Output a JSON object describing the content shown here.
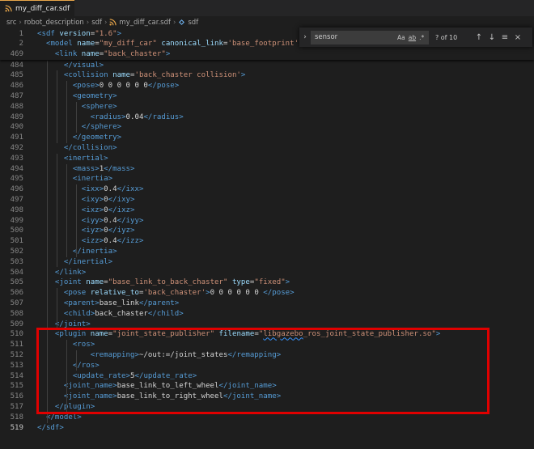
{
  "tab": {
    "label": "my_diff_car.sdf"
  },
  "breadcrumb": {
    "items": [
      "src",
      "robot_description",
      "sdf",
      "my_diff_car.sdf",
      "sdf"
    ]
  },
  "find": {
    "value": "sensor",
    "placeholder": "Find",
    "match_case": "Aa",
    "whole_word": "ab",
    "regex": ".*",
    "count": "? of 10"
  },
  "sticky_lines": [
    {
      "num": "1",
      "code": [
        [
          "t",
          "<"
        ],
        [
          "t",
          "sdf"
        ],
        [
          "x",
          " "
        ],
        [
          "a",
          "version"
        ],
        [
          "x",
          "="
        ],
        [
          "s",
          "\"1.6\""
        ],
        [
          "t",
          ">"
        ]
      ]
    },
    {
      "num": "2",
      "code": [
        [
          "x",
          "  "
        ],
        [
          "t",
          "<"
        ],
        [
          "t",
          "model"
        ],
        [
          "x",
          " "
        ],
        [
          "a",
          "name"
        ],
        [
          "x",
          "="
        ],
        [
          "s",
          "\"my_diff_car\""
        ],
        [
          "x",
          " "
        ],
        [
          "a",
          "canonical_link"
        ],
        [
          "x",
          "="
        ],
        [
          "s",
          "'base_footprint'"
        ]
      ]
    },
    {
      "num": "469",
      "code": [
        [
          "x",
          "    "
        ],
        [
          "t",
          "<"
        ],
        [
          "t",
          "link"
        ],
        [
          "x",
          " "
        ],
        [
          "a",
          "name"
        ],
        [
          "x",
          "="
        ],
        [
          "s",
          "\"back_chaster\""
        ],
        [
          "t",
          ">"
        ]
      ]
    }
  ],
  "lines": [
    {
      "num": "484",
      "code": [
        [
          "x",
          "      "
        ],
        [
          "t",
          "</"
        ],
        [
          "t",
          "visual"
        ],
        [
          "t",
          ">"
        ]
      ]
    },
    {
      "num": "485",
      "code": [
        [
          "x",
          "      "
        ],
        [
          "t",
          "<"
        ],
        [
          "t",
          "collision"
        ],
        [
          "x",
          " "
        ],
        [
          "a",
          "name"
        ],
        [
          "x",
          "="
        ],
        [
          "s",
          "'back_chaster collision'"
        ],
        [
          "t",
          ">"
        ]
      ]
    },
    {
      "num": "486",
      "code": [
        [
          "x",
          "        "
        ],
        [
          "t",
          "<"
        ],
        [
          "t",
          "pose"
        ],
        [
          "t",
          ">"
        ],
        [
          "x",
          "0 0 0 0 0 0"
        ],
        [
          "t",
          "</"
        ],
        [
          "t",
          "pose"
        ],
        [
          "t",
          ">"
        ]
      ]
    },
    {
      "num": "487",
      "code": [
        [
          "x",
          "        "
        ],
        [
          "t",
          "<"
        ],
        [
          "t",
          "geometry"
        ],
        [
          "t",
          ">"
        ]
      ]
    },
    {
      "num": "488",
      "code": [
        [
          "x",
          "          "
        ],
        [
          "t",
          "<"
        ],
        [
          "t",
          "sphere"
        ],
        [
          "t",
          ">"
        ]
      ]
    },
    {
      "num": "489",
      "code": [
        [
          "x",
          "            "
        ],
        [
          "t",
          "<"
        ],
        [
          "t",
          "radius"
        ],
        [
          "t",
          ">"
        ],
        [
          "x",
          "0.04"
        ],
        [
          "t",
          "</"
        ],
        [
          "t",
          "radius"
        ],
        [
          "t",
          ">"
        ]
      ]
    },
    {
      "num": "490",
      "code": [
        [
          "x",
          "          "
        ],
        [
          "t",
          "</"
        ],
        [
          "t",
          "sphere"
        ],
        [
          "t",
          ">"
        ]
      ]
    },
    {
      "num": "491",
      "code": [
        [
          "x",
          "        "
        ],
        [
          "t",
          "</"
        ],
        [
          "t",
          "geometry"
        ],
        [
          "t",
          ">"
        ]
      ]
    },
    {
      "num": "492",
      "code": [
        [
          "x",
          "      "
        ],
        [
          "t",
          "</"
        ],
        [
          "t",
          "collision"
        ],
        [
          "t",
          ">"
        ]
      ]
    },
    {
      "num": "493",
      "code": [
        [
          "x",
          "      "
        ],
        [
          "t",
          "<"
        ],
        [
          "t",
          "inertial"
        ],
        [
          "t",
          ">"
        ]
      ]
    },
    {
      "num": "494",
      "code": [
        [
          "x",
          "        "
        ],
        [
          "t",
          "<"
        ],
        [
          "t",
          "mass"
        ],
        [
          "t",
          ">"
        ],
        [
          "x",
          "1"
        ],
        [
          "t",
          "</"
        ],
        [
          "t",
          "mass"
        ],
        [
          "t",
          ">"
        ]
      ]
    },
    {
      "num": "495",
      "code": [
        [
          "x",
          "        "
        ],
        [
          "t",
          "<"
        ],
        [
          "t",
          "inertia"
        ],
        [
          "t",
          ">"
        ]
      ]
    },
    {
      "num": "496",
      "code": [
        [
          "x",
          "          "
        ],
        [
          "t",
          "<"
        ],
        [
          "t",
          "ixx"
        ],
        [
          "t",
          ">"
        ],
        [
          "x",
          "0.4"
        ],
        [
          "t",
          "</"
        ],
        [
          "t",
          "ixx"
        ],
        [
          "t",
          ">"
        ]
      ]
    },
    {
      "num": "497",
      "code": [
        [
          "x",
          "          "
        ],
        [
          "t",
          "<"
        ],
        [
          "t",
          "ixy"
        ],
        [
          "t",
          ">"
        ],
        [
          "x",
          "0"
        ],
        [
          "t",
          "</"
        ],
        [
          "t",
          "ixy"
        ],
        [
          "t",
          ">"
        ]
      ]
    },
    {
      "num": "498",
      "code": [
        [
          "x",
          "          "
        ],
        [
          "t",
          "<"
        ],
        [
          "t",
          "ixz"
        ],
        [
          "t",
          ">"
        ],
        [
          "x",
          "0"
        ],
        [
          "t",
          "</"
        ],
        [
          "t",
          "ixz"
        ],
        [
          "t",
          ">"
        ]
      ]
    },
    {
      "num": "499",
      "code": [
        [
          "x",
          "          "
        ],
        [
          "t",
          "<"
        ],
        [
          "t",
          "iyy"
        ],
        [
          "t",
          ">"
        ],
        [
          "x",
          "0.4"
        ],
        [
          "t",
          "</"
        ],
        [
          "t",
          "iyy"
        ],
        [
          "t",
          ">"
        ]
      ]
    },
    {
      "num": "500",
      "code": [
        [
          "x",
          "          "
        ],
        [
          "t",
          "<"
        ],
        [
          "t",
          "iyz"
        ],
        [
          "t",
          ">"
        ],
        [
          "x",
          "0"
        ],
        [
          "t",
          "</"
        ],
        [
          "t",
          "iyz"
        ],
        [
          "t",
          ">"
        ]
      ]
    },
    {
      "num": "501",
      "code": [
        [
          "x",
          "          "
        ],
        [
          "t",
          "<"
        ],
        [
          "t",
          "izz"
        ],
        [
          "t",
          ">"
        ],
        [
          "x",
          "0.4"
        ],
        [
          "t",
          "</"
        ],
        [
          "t",
          "izz"
        ],
        [
          "t",
          ">"
        ]
      ]
    },
    {
      "num": "502",
      "code": [
        [
          "x",
          "        "
        ],
        [
          "t",
          "</"
        ],
        [
          "t",
          "inertia"
        ],
        [
          "t",
          ">"
        ]
      ]
    },
    {
      "num": "503",
      "code": [
        [
          "x",
          "      "
        ],
        [
          "t",
          "</"
        ],
        [
          "t",
          "inertial"
        ],
        [
          "t",
          ">"
        ]
      ]
    },
    {
      "num": "504",
      "code": [
        [
          "x",
          "    "
        ],
        [
          "t",
          "</"
        ],
        [
          "t",
          "link"
        ],
        [
          "t",
          ">"
        ]
      ]
    },
    {
      "num": "505",
      "code": [
        [
          "x",
          "    "
        ],
        [
          "t",
          "<"
        ],
        [
          "t",
          "joint"
        ],
        [
          "x",
          " "
        ],
        [
          "a",
          "name"
        ],
        [
          "x",
          "="
        ],
        [
          "s",
          "\"base_link_to_back_chaster\""
        ],
        [
          "x",
          " "
        ],
        [
          "a",
          "type"
        ],
        [
          "x",
          "="
        ],
        [
          "s",
          "\"fixed\""
        ],
        [
          "t",
          ">"
        ]
      ]
    },
    {
      "num": "506",
      "code": [
        [
          "x",
          "      "
        ],
        [
          "t",
          "<"
        ],
        [
          "t",
          "pose"
        ],
        [
          "x",
          " "
        ],
        [
          "a",
          "relative_to"
        ],
        [
          "x",
          "="
        ],
        [
          "s",
          "'back_chaster'"
        ],
        [
          "t",
          ">"
        ],
        [
          "x",
          "0 0 0 0 0 0 "
        ],
        [
          "t",
          "</"
        ],
        [
          "t",
          "pose"
        ],
        [
          "t",
          ">"
        ]
      ]
    },
    {
      "num": "507",
      "code": [
        [
          "x",
          "      "
        ],
        [
          "t",
          "<"
        ],
        [
          "t",
          "parent"
        ],
        [
          "t",
          ">"
        ],
        [
          "x",
          "base_link"
        ],
        [
          "t",
          "</"
        ],
        [
          "t",
          "parent"
        ],
        [
          "t",
          ">"
        ]
      ]
    },
    {
      "num": "508",
      "code": [
        [
          "x",
          "      "
        ],
        [
          "t",
          "<"
        ],
        [
          "t",
          "child"
        ],
        [
          "t",
          ">"
        ],
        [
          "x",
          "back_chaster"
        ],
        [
          "t",
          "</"
        ],
        [
          "t",
          "child"
        ],
        [
          "t",
          ">"
        ]
      ]
    },
    {
      "num": "509",
      "code": [
        [
          "x",
          "    "
        ],
        [
          "t",
          "</"
        ],
        [
          "t",
          "joint"
        ],
        [
          "t",
          ">"
        ]
      ]
    },
    {
      "num": "510",
      "code": [
        [
          "x",
          "    "
        ],
        [
          "t",
          "<"
        ],
        [
          "t",
          "plugin"
        ],
        [
          "x",
          " "
        ],
        [
          "a",
          "name"
        ],
        [
          "x",
          "="
        ],
        [
          "s",
          "\"joint_state_publisher\""
        ],
        [
          "x",
          " "
        ],
        [
          "a",
          "filename"
        ],
        [
          "x",
          "="
        ],
        [
          "s",
          "\""
        ],
        [
          "sq",
          "libgazebo"
        ],
        [
          "s",
          "_ros_joint_state_publisher.so\""
        ],
        [
          "t",
          ">"
        ]
      ]
    },
    {
      "num": "511",
      "code": [
        [
          "x",
          "        "
        ],
        [
          "t",
          "<"
        ],
        [
          "t",
          "ros"
        ],
        [
          "t",
          ">"
        ]
      ]
    },
    {
      "num": "512",
      "code": [
        [
          "x",
          "            "
        ],
        [
          "t",
          "<"
        ],
        [
          "t",
          "remapping"
        ],
        [
          "t",
          ">"
        ],
        [
          "x",
          "~/out:=/joint_states"
        ],
        [
          "t",
          "</"
        ],
        [
          "t",
          "remapping"
        ],
        [
          "t",
          ">"
        ]
      ]
    },
    {
      "num": "513",
      "code": [
        [
          "x",
          "        "
        ],
        [
          "t",
          "</"
        ],
        [
          "t",
          "ros"
        ],
        [
          "t",
          ">"
        ]
      ]
    },
    {
      "num": "514",
      "code": [
        [
          "x",
          "        "
        ],
        [
          "t",
          "<"
        ],
        [
          "t",
          "update_rate"
        ],
        [
          "t",
          ">"
        ],
        [
          "x",
          "5"
        ],
        [
          "t",
          "</"
        ],
        [
          "t",
          "update_rate"
        ],
        [
          "t",
          ">"
        ]
      ]
    },
    {
      "num": "515",
      "code": [
        [
          "x",
          "      "
        ],
        [
          "t",
          "<"
        ],
        [
          "t",
          "joint_name"
        ],
        [
          "t",
          ">"
        ],
        [
          "x",
          "base_link_to_left_wheel"
        ],
        [
          "t",
          "</"
        ],
        [
          "t",
          "joint_name"
        ],
        [
          "t",
          ">"
        ]
      ]
    },
    {
      "num": "516",
      "code": [
        [
          "x",
          "      "
        ],
        [
          "t",
          "<"
        ],
        [
          "t",
          "joint_name"
        ],
        [
          "t",
          ">"
        ],
        [
          "x",
          "base_link_to_right_wheel"
        ],
        [
          "t",
          "</"
        ],
        [
          "t",
          "joint_name"
        ],
        [
          "t",
          ">"
        ]
      ]
    },
    {
      "num": "517",
      "code": [
        [
          "x",
          "    "
        ],
        [
          "t",
          "</"
        ],
        [
          "t",
          "plugin"
        ],
        [
          "t",
          ">"
        ]
      ]
    },
    {
      "num": "518",
      "code": [
        [
          "x",
          "  "
        ],
        [
          "t",
          "</"
        ],
        [
          "t",
          "model"
        ],
        [
          "t",
          ">"
        ]
      ]
    },
    {
      "num": "519",
      "code": [
        [
          "t",
          "</"
        ],
        [
          "t",
          "sdf"
        ],
        [
          "t",
          ">"
        ]
      ],
      "active": true
    }
  ],
  "colors": {
    "tag": "#569cd6",
    "attribute": "#9cdcfe",
    "string": "#ce9178",
    "text": "#d4d4d4",
    "highlight_border": "#e00000"
  }
}
